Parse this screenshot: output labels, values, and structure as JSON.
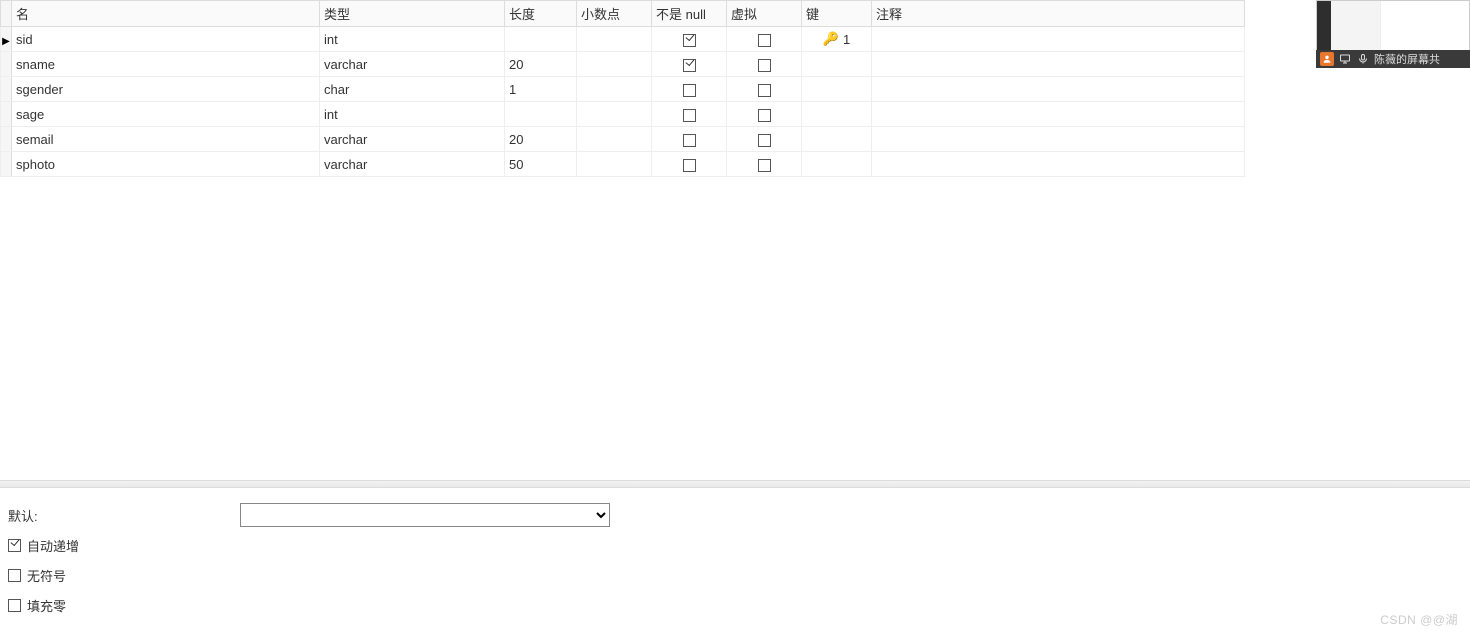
{
  "headers": {
    "name": "名",
    "type": "类型",
    "length": "长度",
    "decimals": "小数点",
    "notnull": "不是 null",
    "virtual": "虚拟",
    "key": "键",
    "comment": "注释"
  },
  "rows": [
    {
      "name": "sid",
      "type": "int",
      "length": "",
      "decimals": "",
      "notnull": true,
      "virtual": false,
      "key": "1",
      "comment": "",
      "active": true
    },
    {
      "name": "sname",
      "type": "varchar",
      "length": "20",
      "decimals": "",
      "notnull": true,
      "virtual": false,
      "key": "",
      "comment": "",
      "active": false
    },
    {
      "name": "sgender",
      "type": "char",
      "length": "1",
      "decimals": "",
      "notnull": false,
      "virtual": false,
      "key": "",
      "comment": "",
      "active": false
    },
    {
      "name": "sage",
      "type": "int",
      "length": "",
      "decimals": "",
      "notnull": false,
      "virtual": false,
      "key": "",
      "comment": "",
      "active": false
    },
    {
      "name": "semail",
      "type": "varchar",
      "length": "20",
      "decimals": "",
      "notnull": false,
      "virtual": false,
      "key": "",
      "comment": "",
      "active": false
    },
    {
      "name": "sphoto",
      "type": "varchar",
      "length": "50",
      "decimals": "",
      "notnull": false,
      "virtual": false,
      "key": "",
      "comment": "",
      "active": false
    }
  ],
  "props": {
    "default_label": "默认:",
    "default_value": "",
    "auto_increment": {
      "label": "自动递增",
      "checked": true
    },
    "unsigned": {
      "label": "无符号",
      "checked": false
    },
    "zerofill": {
      "label": "填充零",
      "checked": false
    }
  },
  "watermark": "CSDN @@湖",
  "floatbar": {
    "text": "陈薇的屏幕共"
  }
}
